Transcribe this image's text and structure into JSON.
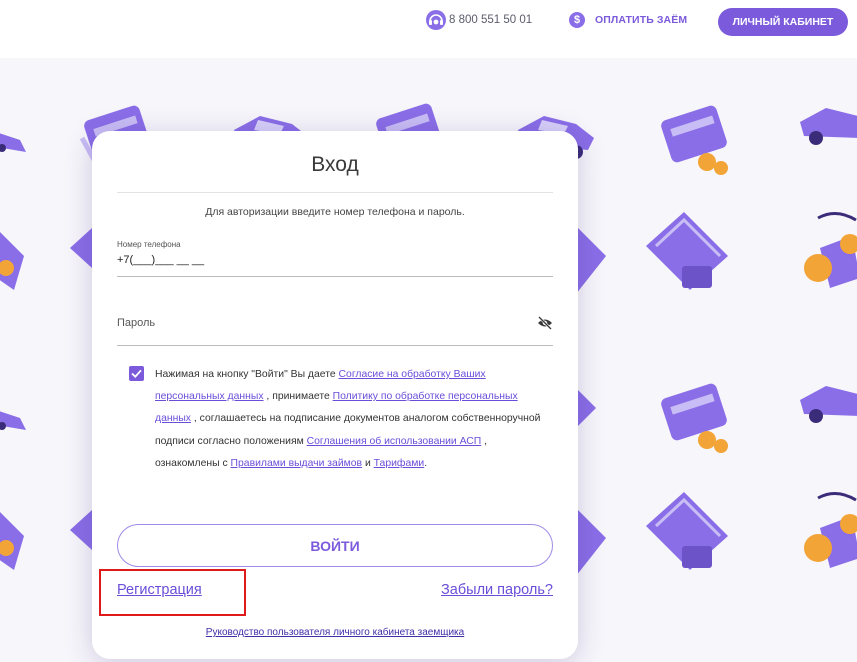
{
  "header": {
    "phone": "8 800 551 50 01",
    "pay_label": "ОПЛАТИТЬ ЗАЁМ",
    "pay_icon_symbol": "$",
    "cabinet_label": "ЛИЧНЫЙ КАБИНЕТ"
  },
  "login": {
    "title": "Вход",
    "hint": "Для авторизации введите номер телефона и пароль.",
    "phone_label": "Номер телефона",
    "phone_value": "+7(___)___ __ __",
    "password_label": "Пароль",
    "consent": {
      "t1": "Нажимая на кнопку \"Войти\" Вы даете ",
      "l1": "Согласие на обработку Ваших персональных данных",
      "t2": " , принимаете ",
      "l2": "Политику по обработке персональных данных",
      "t3": " , соглашаетесь на подписание документов аналогом собственноручной подписи согласно положениям ",
      "l3": "Соглашения об использовании АСП",
      "t4": " , ознакомлены с ",
      "l4": "Правилами выдачи займов",
      "t5": " и ",
      "l5": "Тарифами",
      "t6": "."
    },
    "submit_label": "ВОЙТИ",
    "register_link": "Регистрация",
    "forgot_link": "Забыли пароль?",
    "guide_link": "Руководство пользователя личного кабинета заемщика"
  },
  "colors": {
    "accent": "#7b5bdc",
    "link": "#6a4ed9",
    "highlight": "#e01a1a"
  },
  "icons": [
    "headset-icon",
    "dollar-icon",
    "eye-off-icon",
    "check-icon"
  ]
}
